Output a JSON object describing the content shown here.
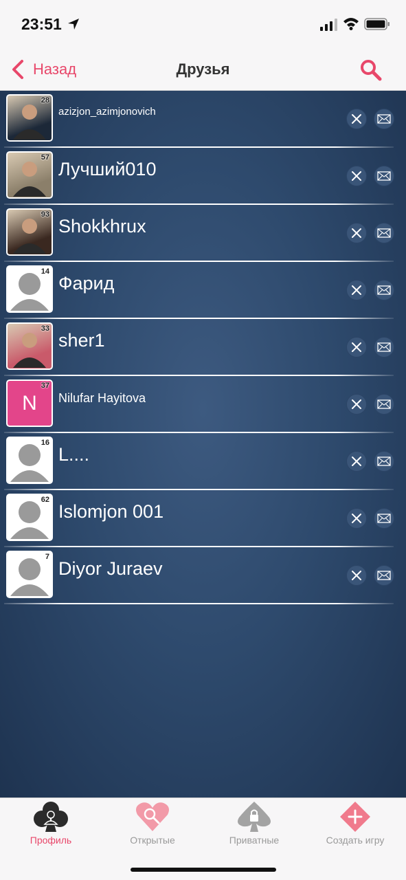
{
  "status_bar": {
    "time": "23:51"
  },
  "nav": {
    "back_label": "Назад",
    "title": "Друзья"
  },
  "friends": [
    {
      "name": "azizjon_azimjonovich",
      "level": "28",
      "avatar": "photo",
      "photo_color": "#1c2838"
    },
    {
      "name": "Лучший010",
      "level": "57",
      "avatar": "photo",
      "photo_color": "#8b7f6a"
    },
    {
      "name": "Shokkhrux",
      "level": "93",
      "avatar": "photo",
      "photo_color": "#3a2820"
    },
    {
      "name": "Фарид",
      "level": "14",
      "avatar": "default"
    },
    {
      "name": "sher1",
      "level": "33",
      "avatar": "photo",
      "photo_color": "#c95a6a"
    },
    {
      "name": "Nilufar Hayitova",
      "level": "37",
      "avatar": "letter",
      "letter": "N"
    },
    {
      "name": "L....",
      "level": "16",
      "avatar": "default"
    },
    {
      "name": "Islomjon 001",
      "level": "62",
      "avatar": "default"
    },
    {
      "name": "Diyor Juraev",
      "level": "7",
      "avatar": "default"
    }
  ],
  "tabs": [
    {
      "label": "Профиль",
      "icon": "club-profile-icon",
      "active": true
    },
    {
      "label": "Открытые",
      "icon": "heart-search-icon",
      "active": false
    },
    {
      "label": "Приватные",
      "icon": "spade-lock-icon",
      "active": false
    },
    {
      "label": "Создать игру",
      "icon": "diamond-plus-icon",
      "active": false
    }
  ],
  "colors": {
    "accent": "#e8476a",
    "list_background": "#2e4a6d"
  }
}
